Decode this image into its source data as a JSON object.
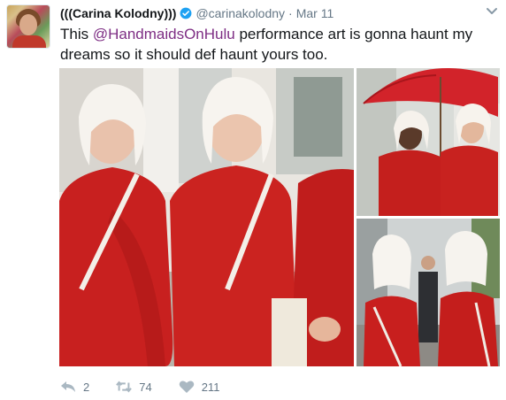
{
  "tweet": {
    "author_name": "(((Carina Kolodny)))",
    "handle": "@carinakolodny",
    "separator": "·",
    "date": "Mar 11",
    "text_before": "This ",
    "mention": "@HandmaidsOnHulu",
    "text_after": " performance art is gonna haunt my dreams so it should def haunt yours too."
  },
  "actions": {
    "reply_count": "2",
    "retweet_count": "74",
    "like_count": "211"
  },
  "icons": {
    "verified": "verified-badge-icon",
    "menu": "chevron-down-icon",
    "reply": "reply-icon",
    "retweet": "retweet-icon",
    "like": "heart-icon"
  },
  "colors": {
    "mention": "#7e2e84",
    "verified": "#1da1f2",
    "muted": "#657786"
  }
}
